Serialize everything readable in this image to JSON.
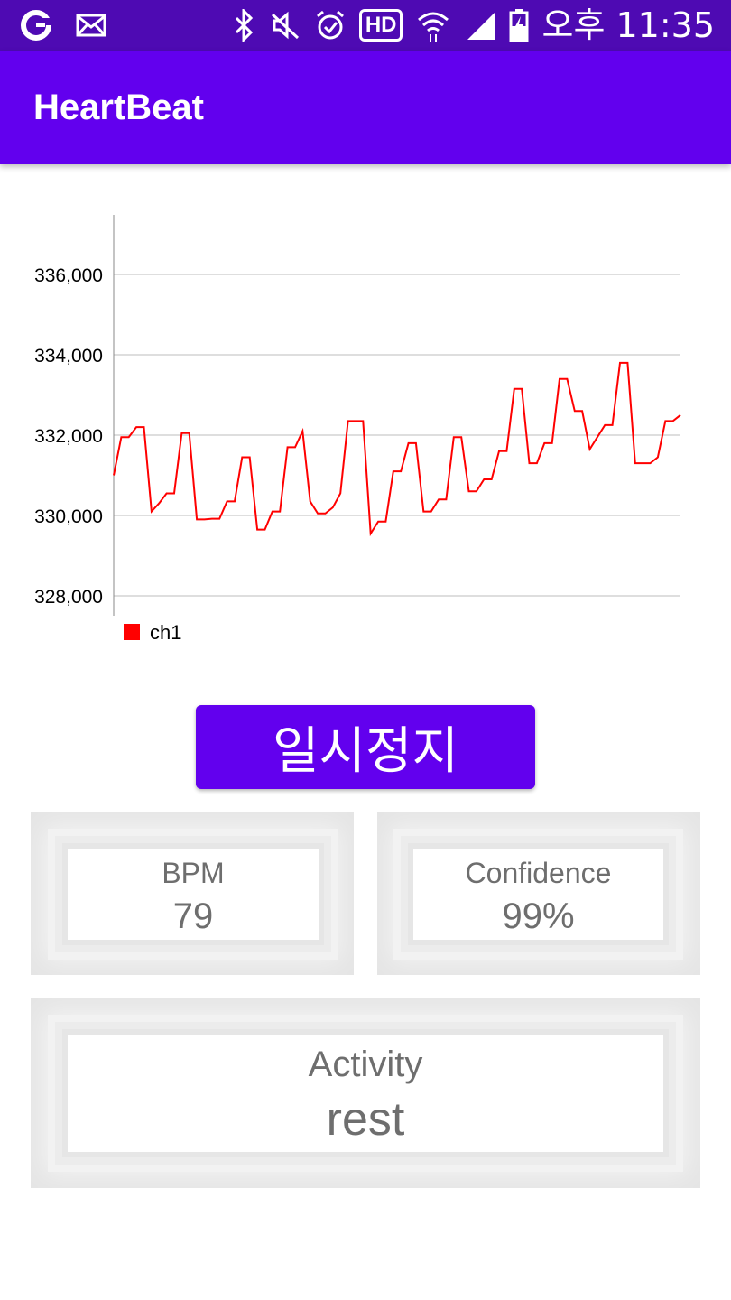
{
  "status_bar": {
    "time": "오후 11:35",
    "left_icons": [
      "app-g-icon",
      "mail-icon"
    ],
    "right_icons": [
      "bluetooth-icon",
      "mute-icon",
      "alarm-icon",
      "hd-icon",
      "wifi-icon",
      "signal-icon",
      "battery-charging-icon"
    ],
    "hd_label": "HD"
  },
  "app_bar": {
    "title": "HeartBeat",
    "color": "#6200ee"
  },
  "chart_data": {
    "type": "line",
    "title": "",
    "xlabel": "",
    "ylabel": "",
    "ylim": [
      327500,
      337500
    ],
    "y_ticks": [
      "328,000",
      "330,000",
      "332,000",
      "334,000",
      "336,000"
    ],
    "y_tick_values": [
      328000,
      330000,
      332000,
      334000,
      336000
    ],
    "grid": true,
    "legend_position": "bottom-left",
    "series": [
      {
        "name": "ch1",
        "color": "#ff0000",
        "values": [
          331000,
          331950,
          331950,
          332200,
          332200,
          330100,
          330300,
          330550,
          330550,
          332050,
          332050,
          329900,
          329900,
          329920,
          329920,
          330350,
          330350,
          331450,
          331450,
          329650,
          329650,
          330100,
          330100,
          331700,
          331700,
          332100,
          330350,
          330050,
          330050,
          330200,
          330550,
          332350,
          332350,
          332350,
          329550,
          329850,
          329850,
          331100,
          331100,
          331800,
          331800,
          330100,
          330100,
          330400,
          330400,
          331950,
          331950,
          330600,
          330600,
          330900,
          330900,
          331600,
          331600,
          333150,
          333150,
          331300,
          331300,
          331800,
          331800,
          333400,
          333400,
          332600,
          332600,
          331650,
          331950,
          332250,
          332250,
          333800,
          333800,
          331300,
          331300,
          331300,
          331450,
          332350,
          332350,
          332500
        ]
      }
    ]
  },
  "controls": {
    "pause_label": "일시정지"
  },
  "cards": {
    "bpm": {
      "label": "BPM",
      "value": "79"
    },
    "confidence": {
      "label": "Confidence",
      "value": "99%"
    },
    "activity": {
      "label": "Activity",
      "value": "rest"
    }
  }
}
